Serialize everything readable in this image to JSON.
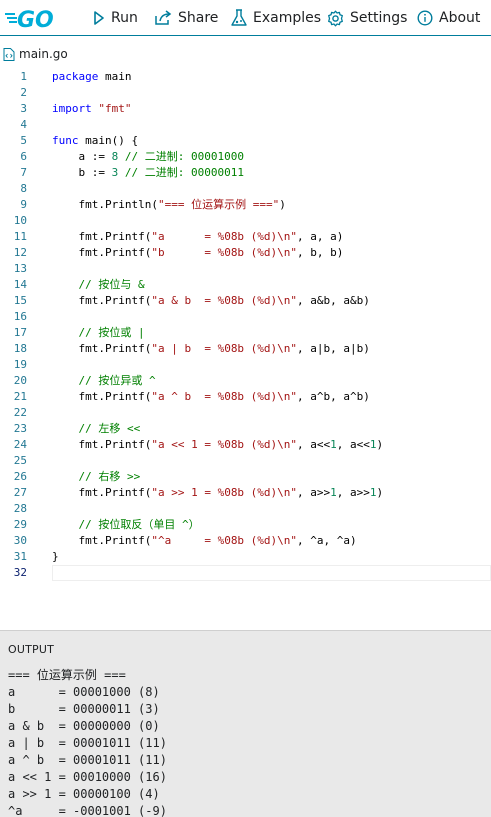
{
  "toolbar": {
    "logo_text": "GO",
    "run_label": "Run",
    "share_label": "Share",
    "examples_label": "Examples",
    "settings_label": "Settings",
    "about_label": "About",
    "accent_color": "#007d9c"
  },
  "file_tab": {
    "name": "main.go",
    "icon": "file-code-icon"
  },
  "editor": {
    "current_line": 32,
    "lines": [
      {
        "n": "1",
        "tokens": [
          {
            "t": "kw",
            "v": "package"
          },
          {
            "t": "p",
            "v": " main"
          }
        ]
      },
      {
        "n": "2",
        "tokens": []
      },
      {
        "n": "3",
        "tokens": [
          {
            "t": "kw",
            "v": "import"
          },
          {
            "t": "p",
            "v": " "
          },
          {
            "t": "str",
            "v": "\"fmt\""
          }
        ]
      },
      {
        "n": "4",
        "tokens": []
      },
      {
        "n": "5",
        "tokens": [
          {
            "t": "kw",
            "v": "func"
          },
          {
            "t": "p",
            "v": " main() {"
          }
        ]
      },
      {
        "n": "6",
        "tokens": [
          {
            "t": "p",
            "v": "    a := "
          },
          {
            "t": "num",
            "v": "8"
          },
          {
            "t": "p",
            "v": " "
          },
          {
            "t": "cmt",
            "v": "// 二进制: 00001000"
          }
        ]
      },
      {
        "n": "7",
        "tokens": [
          {
            "t": "p",
            "v": "    b := "
          },
          {
            "t": "num",
            "v": "3"
          },
          {
            "t": "p",
            "v": " "
          },
          {
            "t": "cmt",
            "v": "// 二进制: 00000011"
          }
        ]
      },
      {
        "n": "8",
        "tokens": []
      },
      {
        "n": "9",
        "tokens": [
          {
            "t": "p",
            "v": "    fmt.Println("
          },
          {
            "t": "str",
            "v": "\"=== 位运算示例 ===\""
          },
          {
            "t": "p",
            "v": ")"
          }
        ]
      },
      {
        "n": "10",
        "tokens": []
      },
      {
        "n": "11",
        "tokens": [
          {
            "t": "p",
            "v": "    fmt.Printf("
          },
          {
            "t": "str",
            "v": "\"a      = %08b (%d)\\n\""
          },
          {
            "t": "p",
            "v": ", a, a)"
          }
        ]
      },
      {
        "n": "12",
        "tokens": [
          {
            "t": "p",
            "v": "    fmt.Printf("
          },
          {
            "t": "str",
            "v": "\"b      = %08b (%d)\\n\""
          },
          {
            "t": "p",
            "v": ", b, b)"
          }
        ]
      },
      {
        "n": "13",
        "tokens": []
      },
      {
        "n": "14",
        "tokens": [
          {
            "t": "p",
            "v": "    "
          },
          {
            "t": "cmt",
            "v": "// 按位与 &"
          }
        ]
      },
      {
        "n": "15",
        "tokens": [
          {
            "t": "p",
            "v": "    fmt.Printf("
          },
          {
            "t": "str",
            "v": "\"a & b  = %08b (%d)\\n\""
          },
          {
            "t": "p",
            "v": ", a&b, a&b)"
          }
        ]
      },
      {
        "n": "16",
        "tokens": []
      },
      {
        "n": "17",
        "tokens": [
          {
            "t": "p",
            "v": "    "
          },
          {
            "t": "cmt",
            "v": "// 按位或 |"
          }
        ]
      },
      {
        "n": "18",
        "tokens": [
          {
            "t": "p",
            "v": "    fmt.Printf("
          },
          {
            "t": "str",
            "v": "\"a | b  = %08b (%d)\\n\""
          },
          {
            "t": "p",
            "v": ", a|b, a|b)"
          }
        ]
      },
      {
        "n": "19",
        "tokens": []
      },
      {
        "n": "20",
        "tokens": [
          {
            "t": "p",
            "v": "    "
          },
          {
            "t": "cmt",
            "v": "// 按位异或 ^"
          }
        ]
      },
      {
        "n": "21",
        "tokens": [
          {
            "t": "p",
            "v": "    fmt.Printf("
          },
          {
            "t": "str",
            "v": "\"a ^ b  = %08b (%d)\\n\""
          },
          {
            "t": "p",
            "v": ", a^b, a^b)"
          }
        ]
      },
      {
        "n": "22",
        "tokens": []
      },
      {
        "n": "23",
        "tokens": [
          {
            "t": "p",
            "v": "    "
          },
          {
            "t": "cmt",
            "v": "// 左移 <<"
          }
        ]
      },
      {
        "n": "24",
        "tokens": [
          {
            "t": "p",
            "v": "    fmt.Printf("
          },
          {
            "t": "str",
            "v": "\"a << 1 = %08b (%d)\\n\""
          },
          {
            "t": "p",
            "v": ", a<<"
          },
          {
            "t": "num",
            "v": "1"
          },
          {
            "t": "p",
            "v": ", a<<"
          },
          {
            "t": "num",
            "v": "1"
          },
          {
            "t": "p",
            "v": ")"
          }
        ]
      },
      {
        "n": "25",
        "tokens": []
      },
      {
        "n": "26",
        "tokens": [
          {
            "t": "p",
            "v": "    "
          },
          {
            "t": "cmt",
            "v": "// 右移 >>"
          }
        ]
      },
      {
        "n": "27",
        "tokens": [
          {
            "t": "p",
            "v": "    fmt.Printf("
          },
          {
            "t": "str",
            "v": "\"a >> 1 = %08b (%d)\\n\""
          },
          {
            "t": "p",
            "v": ", a>>"
          },
          {
            "t": "num",
            "v": "1"
          },
          {
            "t": "p",
            "v": ", a>>"
          },
          {
            "t": "num",
            "v": "1"
          },
          {
            "t": "p",
            "v": ")"
          }
        ]
      },
      {
        "n": "28",
        "tokens": []
      },
      {
        "n": "29",
        "tokens": [
          {
            "t": "p",
            "v": "    "
          },
          {
            "t": "cmt",
            "v": "// 按位取反（单目 ^）"
          }
        ]
      },
      {
        "n": "30",
        "tokens": [
          {
            "t": "p",
            "v": "    fmt.Printf("
          },
          {
            "t": "str",
            "v": "\"^a     = %08b (%d)\\n\""
          },
          {
            "t": "p",
            "v": ", ^a, ^a)"
          }
        ]
      },
      {
        "n": "31",
        "tokens": [
          {
            "t": "p",
            "v": "}"
          }
        ]
      },
      {
        "n": "32",
        "tokens": []
      }
    ]
  },
  "output": {
    "title": "OUTPUT",
    "lines": [
      "=== 位运算示例 ===",
      "a      = 00001000 (8)",
      "b      = 00000011 (3)",
      "a & b  = 00000000 (0)",
      "a | b  = 00001011 (11)",
      "a ^ b  = 00001011 (11)",
      "a << 1 = 00010000 (16)",
      "a >> 1 = 00000100 (4)",
      "^a     = -0001001 (-9)"
    ]
  }
}
